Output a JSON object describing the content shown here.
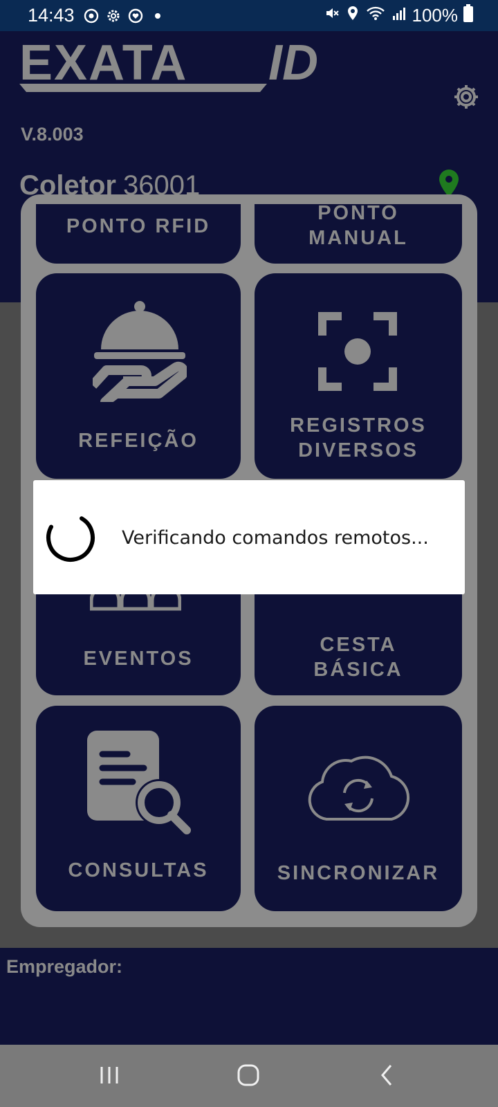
{
  "status_bar": {
    "time": "14:43",
    "battery_percent": "100%",
    "icons": [
      "sync-icon",
      "settings-icon",
      "heart-icon",
      "dot-icon",
      "mute-icon",
      "location-icon",
      "wifi-icon",
      "signal-icon",
      "battery-icon"
    ]
  },
  "header": {
    "logo_text": "EXATA ID",
    "version": "V.8.003",
    "coletor_label": "Coletor",
    "coletor_number": "36001",
    "pin_color": "#1f7a1f"
  },
  "tiles": {
    "ponto_rfid": "PONTO RFID",
    "ponto_manual_line1": "PONTO",
    "ponto_manual_line2": "MANUAL",
    "refeicao": "REFEIÇÃO",
    "registros_line1": "REGISTROS",
    "registros_line2": "DIVERSOS",
    "eventos": "EVENTOS",
    "cesta_line1": "CESTA",
    "cesta_line2": "BÁSICA",
    "consultas": "CONSULTAS",
    "sincronizar": "SINCRONIZAR"
  },
  "footer": {
    "empregador_label": "Empregador:"
  },
  "dialog": {
    "message": "Verificando comandos remotos..."
  },
  "colors": {
    "status_bar_bg": "#0a2a53",
    "app_dark_blue": "#0e1137",
    "dim_text": "#8a8a8a"
  }
}
